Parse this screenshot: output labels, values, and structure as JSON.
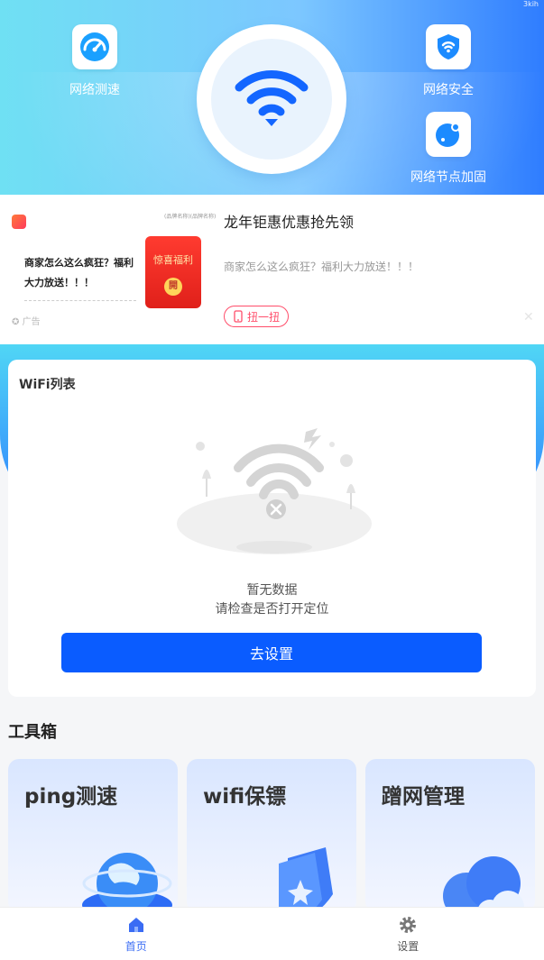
{
  "status": {
    "corner_text": "3kih"
  },
  "hero": {
    "features": {
      "speed": {
        "label": "网络测速",
        "icon": "speedometer-icon"
      },
      "security": {
        "label": "网络安全",
        "icon": "shield-icon"
      },
      "accelerate": {
        "label": "网络节点加固",
        "icon": "node-icon"
      }
    },
    "center_icon": "wifi-icon"
  },
  "ad": {
    "top_small_text": "(品牌名称)(品牌名称)",
    "left_text": "商家怎么这么疯狂？福利大力放送！！！",
    "redpacket_title": "惊喜福利",
    "redpacket_coin": "開",
    "ad_tag": "广告",
    "title": "龙年钜惠优惠抢先领",
    "desc": "商家怎么这么疯狂？福利大力放送！！！",
    "twist_label": "扭一扭",
    "close": "✕"
  },
  "wifi_list": {
    "title": "WiFi列表",
    "empty_line1": "暂无数据",
    "empty_line2": "请检查是否打开定位",
    "setup_button": "去设置"
  },
  "toolbox": {
    "title": "工具箱",
    "tools": [
      {
        "label": "ping测速"
      },
      {
        "label": "wifi保镖"
      },
      {
        "label": "蹭网管理"
      }
    ]
  },
  "bottom_nav": {
    "home": "首页",
    "settings": "设置"
  },
  "colors": {
    "primary": "#0a5cff",
    "nav_active": "#3a6cf4",
    "ad_accent": "#ff4d6a"
  }
}
